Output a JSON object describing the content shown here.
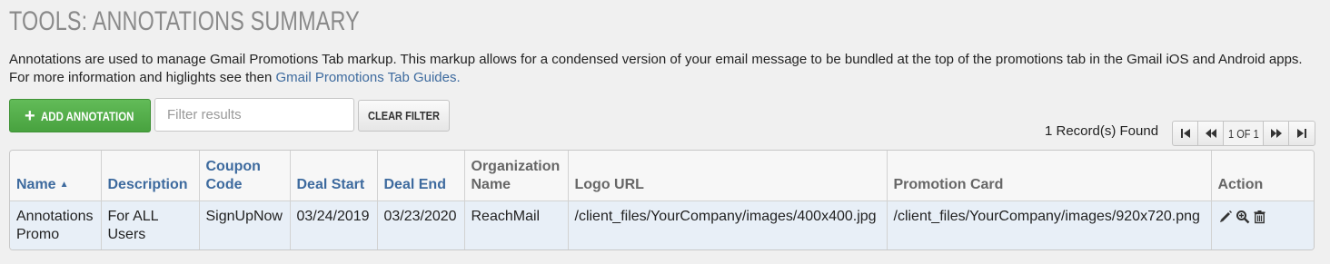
{
  "page": {
    "title": "TOOLS: ANNOTATIONS SUMMARY",
    "description_text": "Annotations are used to manage Gmail Promotions Tab markup. This markup allows for a condensed version of your email message to be bundled at the top of the promotions tab in the Gmail iOS and Android apps. For more information and higlights see then ",
    "description_link": "Gmail Promotions Tab Guides."
  },
  "toolbar": {
    "add_label": "ADD ANNOTATION",
    "add_icon": "plus-icon",
    "filter_placeholder": "Filter results",
    "filter_value": "",
    "clear_label": "CLEAR FILTER"
  },
  "pagination": {
    "records_text": "1 Record(s) Found",
    "page_info": "1 OF 1",
    "icons": [
      "first-page-icon",
      "previous-page-icon",
      "next-page-icon",
      "last-page-icon"
    ]
  },
  "table": {
    "columns": [
      {
        "label": "Name",
        "sorted": "ascending"
      },
      {
        "label": "Description"
      },
      {
        "label": "Coupon Code"
      },
      {
        "label": "Deal Start"
      },
      {
        "label": "Deal End"
      },
      {
        "label": "Organization Name"
      },
      {
        "label": "Logo URL"
      },
      {
        "label": "Promotion Card"
      },
      {
        "label": "Action"
      }
    ],
    "rows": [
      {
        "name": "Annotations Promo",
        "description": "For ALL Users",
        "coupon_code": "SignUpNow",
        "deal_start": "03/24/2019",
        "deal_end": "03/23/2020",
        "organization": "ReachMail",
        "logo_url": "/client_files/YourCompany/images/400x400.jpg",
        "promotion_card": "/client_files/YourCompany/images/920x720.png",
        "actions": [
          "edit-icon",
          "view-icon",
          "delete-icon"
        ]
      }
    ]
  },
  "colors": {
    "accent_link": "#3d6a9e",
    "add_button": "#4fab46",
    "row_highlight": "#e8eff7",
    "title": "#8a8a8a"
  }
}
